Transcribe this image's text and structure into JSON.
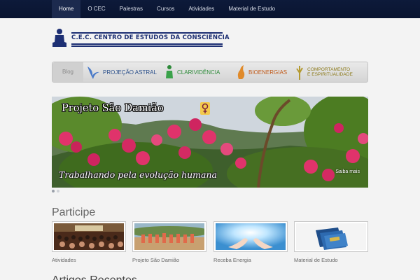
{
  "nav": {
    "items": [
      {
        "label": "Home",
        "active": true
      },
      {
        "label": "O CEC"
      },
      {
        "label": "Palestras"
      },
      {
        "label": "Cursos"
      },
      {
        "label": "Atividades"
      },
      {
        "label": "Material de Estudo"
      }
    ]
  },
  "logo": {
    "text": "C.E.C. CENTRO DE ESTUDOS DA CONSCIÊNCIA"
  },
  "categories": {
    "blog": "Blog",
    "items": [
      {
        "label": "PROJEÇÃO ASTRAL",
        "color": "#2a4f8a",
        "icon": "bird-icon"
      },
      {
        "label": "CLARIVIDÊNCIA",
        "color": "#2e8a3a",
        "icon": "figure-icon"
      },
      {
        "label": "BIOENERGIAS",
        "color": "#c05a1a",
        "icon": "flame-icon"
      },
      {
        "label": "COMPORTAMENTO",
        "label2": "E ESPIRITUALIDADE",
        "color": "#8c7a1a",
        "icon": "tree-icon"
      }
    ]
  },
  "hero": {
    "title": "Projeto São Damião",
    "caption": "Trabalhando pela evolução humana",
    "more": "Saiba mais",
    "slide_count": 2,
    "active_slide": 1
  },
  "participe": {
    "title": "Participe",
    "cards": [
      {
        "label": "Atividades",
        "image": "audience-photo"
      },
      {
        "label": "Projeto São Damião",
        "image": "group-photo"
      },
      {
        "label": "Receba Energia",
        "image": "hands-light-photo"
      },
      {
        "label": "Material de Estudo",
        "image": "books-photo"
      }
    ]
  },
  "next_section": {
    "title": "Artigos Recentes"
  },
  "colors": {
    "nav_bg": "#0d1a3a",
    "brand_blue": "#1d2f73",
    "flowers": "#e0336b"
  }
}
